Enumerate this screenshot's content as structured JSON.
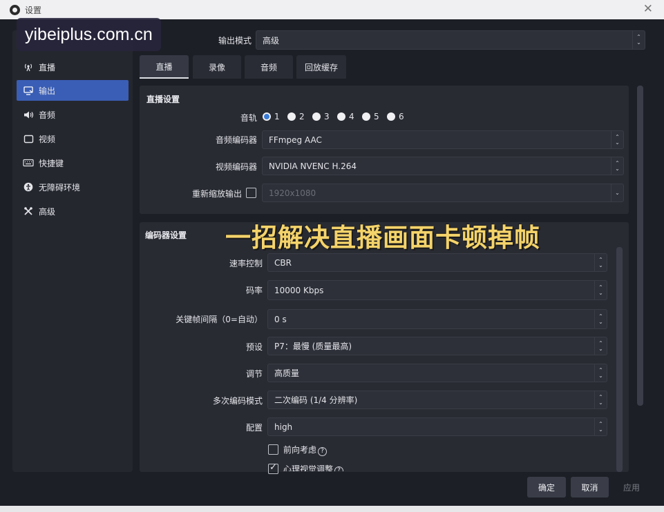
{
  "window": {
    "title": "设置"
  },
  "watermark": "yibeiplus.com.cn",
  "sidebar": {
    "items": [
      {
        "label": "直播",
        "icon": "antenna-icon"
      },
      {
        "label": "输出",
        "icon": "monitor-output-icon",
        "active": true
      },
      {
        "label": "音频",
        "icon": "speaker-icon"
      },
      {
        "label": "视频",
        "icon": "display-icon"
      },
      {
        "label": "快捷键",
        "icon": "keyboard-icon"
      },
      {
        "label": "无障碍环境",
        "icon": "accessibility-icon"
      },
      {
        "label": "高级",
        "icon": "tools-icon"
      }
    ]
  },
  "output_mode": {
    "label": "输出模式",
    "value": "高级"
  },
  "tabs": [
    "直播",
    "录像",
    "音频",
    "回放缓存"
  ],
  "stream_settings": {
    "title": "直播设置",
    "audio_track_label": "音轨",
    "tracks": [
      "1",
      "2",
      "3",
      "4",
      "5",
      "6"
    ],
    "selected_track": "1",
    "audio_encoder": {
      "label": "音频编码器",
      "value": "FFmpeg AAC"
    },
    "video_encoder": {
      "label": "视频编码器",
      "value": "NVIDIA NVENC H.264"
    },
    "rescale": {
      "label": "重新缩放输出",
      "value": "1920x1080",
      "checked": false
    }
  },
  "overlay_caption": "一招解决直播画面卡顿掉帧",
  "encoder_settings": {
    "title": "编码器设置",
    "rate_control": {
      "label": "速率控制",
      "value": "CBR"
    },
    "bitrate": {
      "label": "码率",
      "value": "10000 Kbps"
    },
    "keyframe": {
      "label": "关键帧间隔（0=自动）",
      "value": "0 s"
    },
    "preset": {
      "label": "预设",
      "value": "P7：最慢 (质量最高)"
    },
    "tuning": {
      "label": "调节",
      "value": "高质量"
    },
    "multipass": {
      "label": "多次编码模式",
      "value": "二次编码 (1/4 分辨率)"
    },
    "profile": {
      "label": "配置",
      "value": "high"
    },
    "lookahead": {
      "label": "前向考虑",
      "checked": false
    },
    "psycho": {
      "label": "心理视觉调整",
      "checked": true
    }
  },
  "buttons": {
    "ok": "确定",
    "cancel": "取消",
    "apply": "应用"
  }
}
